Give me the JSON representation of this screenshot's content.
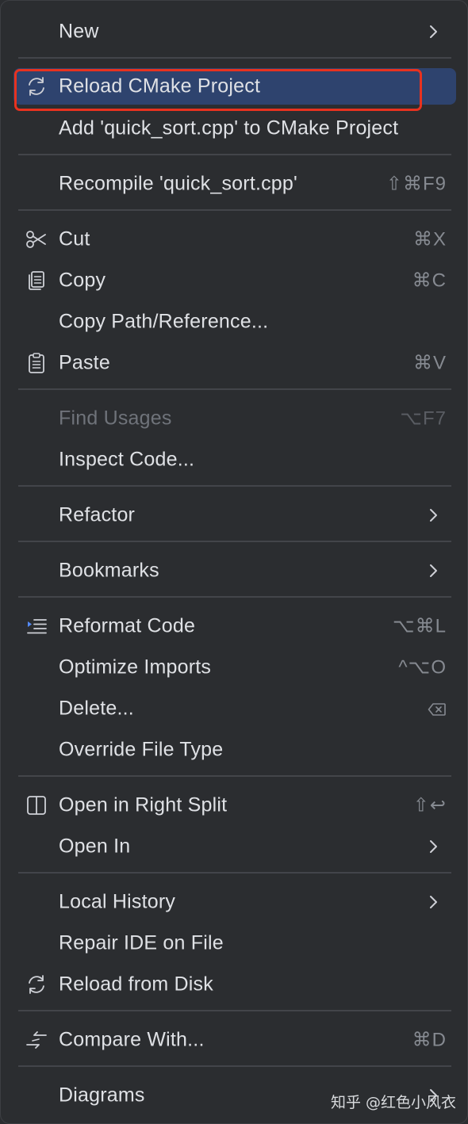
{
  "menu": {
    "items": [
      {
        "label": "New",
        "submenu": true
      },
      {
        "label": "Reload CMake Project",
        "icon": "reload-icon",
        "selected": true
      },
      {
        "label": "Add 'quick_sort.cpp' to CMake Project"
      },
      {
        "label": "Recompile 'quick_sort.cpp'",
        "shortcut": "⇧⌘F9"
      },
      {
        "label": "Cut",
        "icon": "scissors-icon",
        "shortcut": "⌘X"
      },
      {
        "label": "Copy",
        "icon": "copy-icon",
        "shortcut": "⌘C"
      },
      {
        "label": "Copy Path/Reference..."
      },
      {
        "label": "Paste",
        "icon": "clipboard-icon",
        "shortcut": "⌘V"
      },
      {
        "label": "Find Usages",
        "shortcut": "⌥F7",
        "disabled": true
      },
      {
        "label": "Inspect Code..."
      },
      {
        "label": "Refactor",
        "submenu": true
      },
      {
        "label": "Bookmarks",
        "submenu": true
      },
      {
        "label": "Reformat Code",
        "icon": "reformat-icon",
        "shortcut": "⌥⌘L"
      },
      {
        "label": "Optimize Imports",
        "shortcut": "^⌥O"
      },
      {
        "label": "Delete...",
        "shortcut_icon": "delete-key-icon"
      },
      {
        "label": "Override File Type"
      },
      {
        "label": "Open in Right Split",
        "icon": "split-icon",
        "shortcut": "⇧↩"
      },
      {
        "label": "Open In",
        "submenu": true
      },
      {
        "label": "Local History",
        "submenu": true
      },
      {
        "label": "Repair IDE on File"
      },
      {
        "label": "Reload from Disk",
        "icon": "reload-icon"
      },
      {
        "label": "Compare With...",
        "icon": "compare-icon",
        "shortcut": "⌘D"
      },
      {
        "label": "Diagrams",
        "submenu": true
      }
    ]
  },
  "watermark": "知乎 @红色小风衣",
  "colors": {
    "background": "#2b2d30",
    "selected": "#2e436e",
    "highlight_box": "#e8321f",
    "text": "#dfe1e5",
    "disabled_text": "#6f737a",
    "shortcut_text": "#868a91",
    "icon_blue": "#548af7"
  }
}
